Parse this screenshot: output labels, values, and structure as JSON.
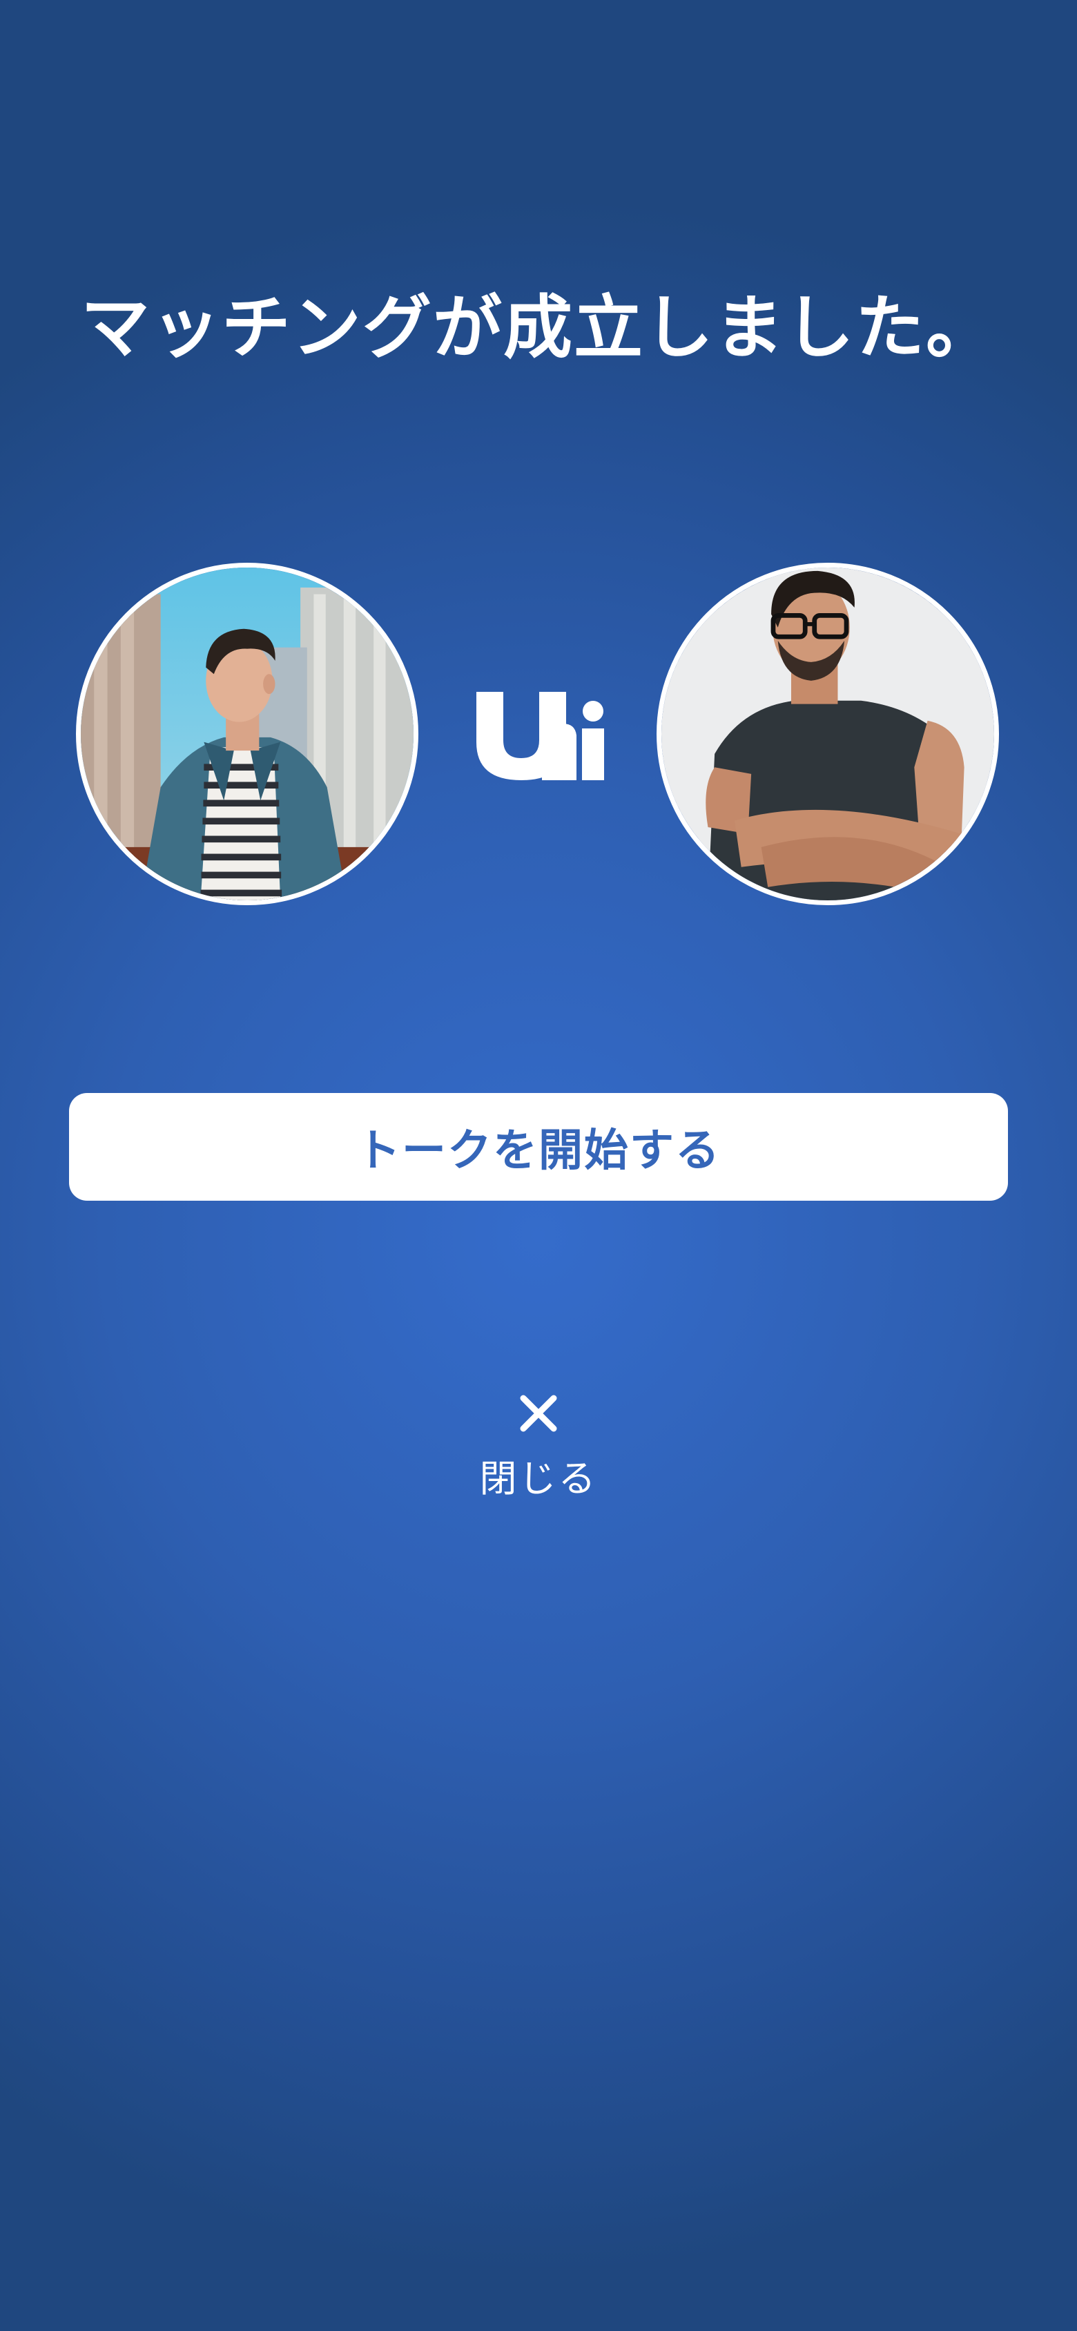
{
  "screen": {
    "title": "マッチングが成立しました。",
    "logo_name": "ui-logo",
    "colors": {
      "background_center": "#356ccb",
      "background_edge": "#1f477f",
      "button_text": "#3566b9",
      "text": "#ffffff"
    }
  },
  "profiles": {
    "left": {
      "image": "profile-photo-man-striped-shirt"
    },
    "right": {
      "image": "profile-photo-man-glasses-black-tank"
    }
  },
  "actions": {
    "start_talk_label": "トークを開始する",
    "close_icon": "close-icon",
    "close_label": "閉じる"
  }
}
